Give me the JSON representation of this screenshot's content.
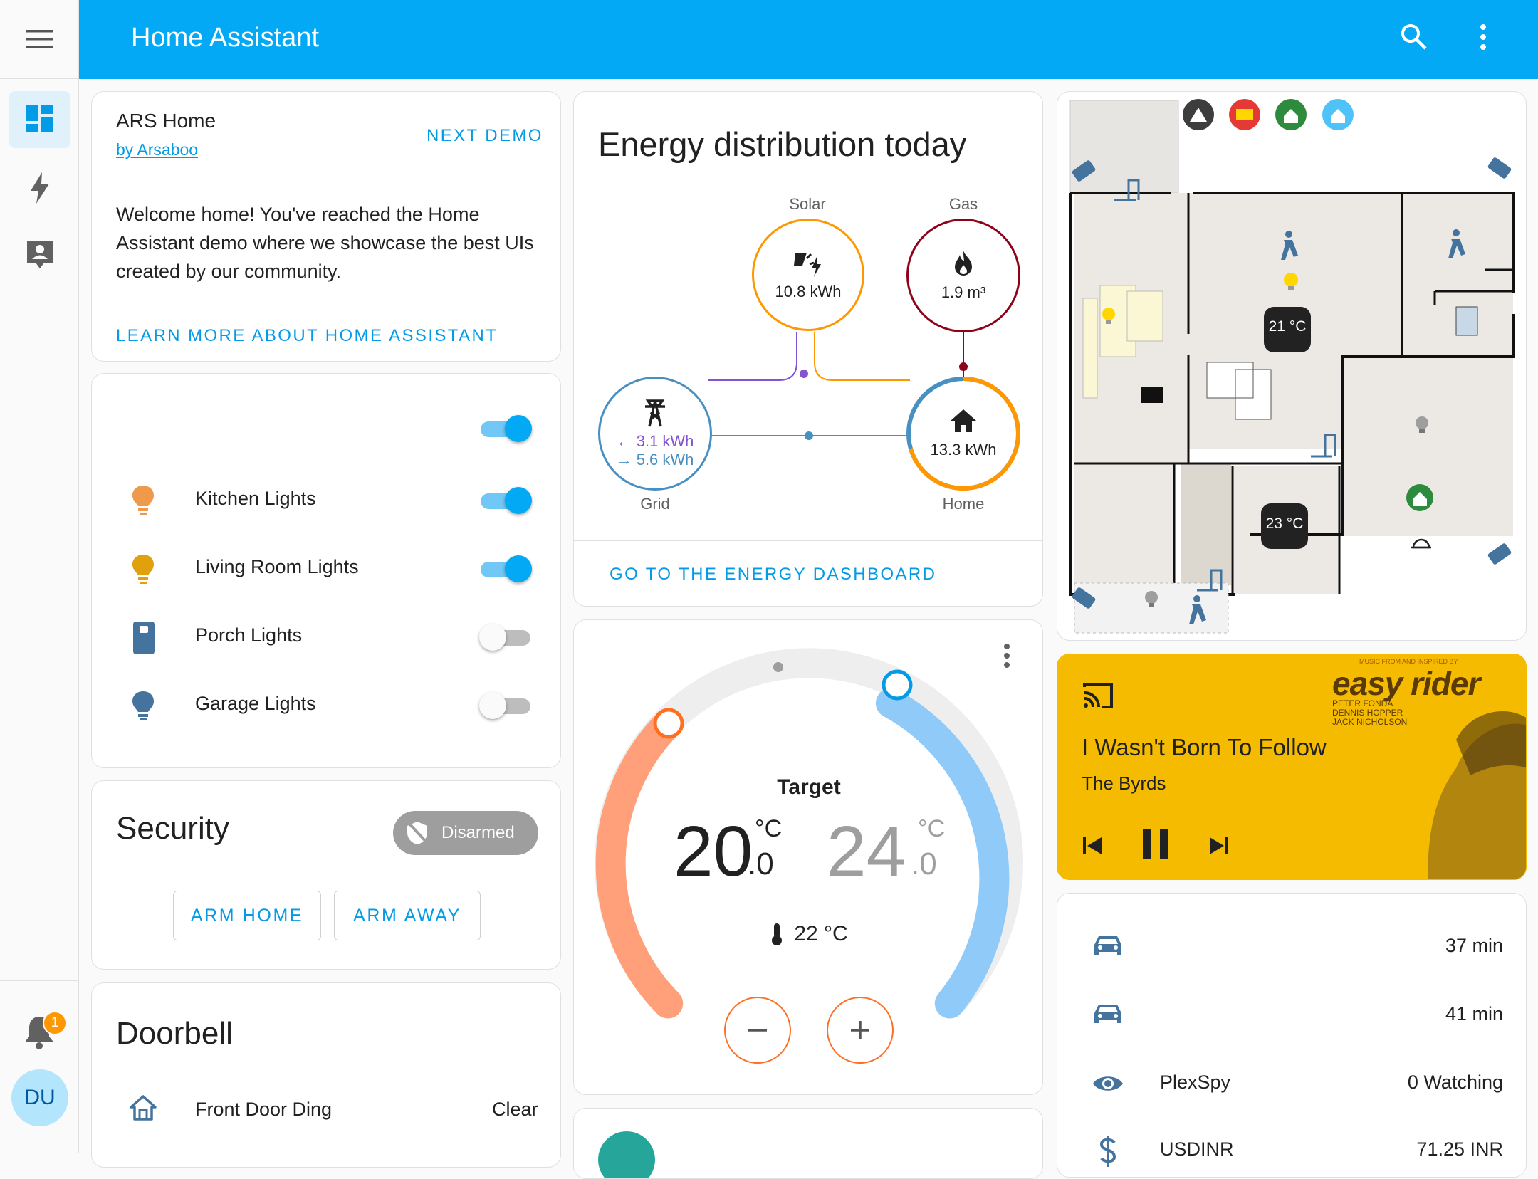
{
  "app": {
    "title": "Home Assistant"
  },
  "sidebar": {
    "notification_count": "1",
    "user_initials": "DU"
  },
  "intro": {
    "title": "ARS Home",
    "author": "by Arsaboo",
    "next_label": "NEXT DEMO",
    "body": "Welcome home! You've reached the Home Assistant demo where we showcase the best UIs created by our community.",
    "link_label": "LEARN MORE ABOUT HOME ASSISTANT"
  },
  "lights": {
    "items": [
      {
        "label": "Kitchen Lights",
        "on": true,
        "color": "#ef9a4a"
      },
      {
        "label": "Living Room Lights",
        "on": true,
        "color": "#e0a10c"
      },
      {
        "label": "Porch Lights",
        "on": false,
        "color": "#44739e"
      },
      {
        "label": "Garage Lights",
        "on": false,
        "color": "#44739e"
      }
    ]
  },
  "security": {
    "title": "Security",
    "state": "Disarmed",
    "arm_home": "ARM HOME",
    "arm_away": "ARM AWAY"
  },
  "doorbell": {
    "title": "Doorbell",
    "row_label": "Front Door Ding",
    "row_state": "Clear"
  },
  "energy": {
    "title": "Energy distribution today",
    "solar_label": "Solar",
    "solar_value": "10.8 kWh",
    "gas_label": "Gas",
    "gas_value": "1.9 m³",
    "grid_label": "Grid",
    "grid_in": "3.1 kWh",
    "grid_out": "5.6 kWh",
    "home_label": "Home",
    "home_value": "13.3 kWh",
    "link_label": "GO TO THE ENERGY DASHBOARD",
    "colors": {
      "solar": "#ff9800",
      "gas": "#8e021b",
      "grid": "#488fc2",
      "return": "#8353d1"
    }
  },
  "thermostat": {
    "target_label": "Target",
    "low_int": "20",
    "low_dec": ".0",
    "high_int": "24",
    "high_dec": ".0",
    "unit": "°C",
    "current": "22 °C",
    "heat_color": "#ffa07a",
    "cool_color": "#90caf9"
  },
  "floorplan": {
    "temp1": "21 °C",
    "temp2": "23 °C"
  },
  "media": {
    "title": "I Wasn't Born To Follow",
    "artist": "The Byrds",
    "album_art_text": "easy rider",
    "album_credits": [
      "PETER FONDA",
      "DENNIS HOPPER",
      "JACK NICHOLSON"
    ],
    "album_banner": "MUSIC FROM AND INSPIRED BY",
    "bg": "#f4bb00"
  },
  "entities": {
    "rows": [
      {
        "icon": "car-icon",
        "label": "",
        "value": "37 min"
      },
      {
        "icon": "car-icon",
        "label": "",
        "value": "41 min"
      },
      {
        "icon": "eye-icon",
        "label": "PlexSpy",
        "value": "0 Watching"
      },
      {
        "icon": "currency-icon",
        "label": "USDINR",
        "value": "71.25 INR"
      }
    ]
  }
}
